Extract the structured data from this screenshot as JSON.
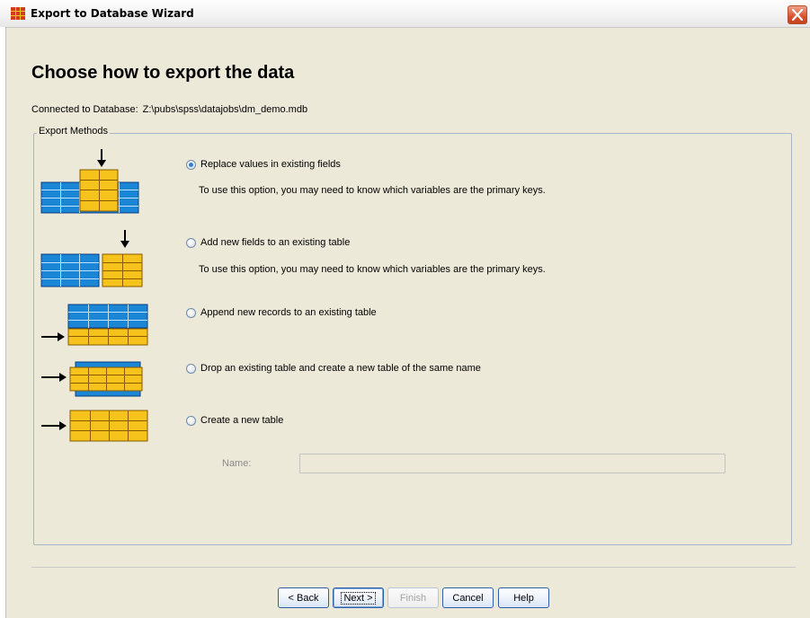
{
  "window": {
    "title": "Export to Database Wizard"
  },
  "page": {
    "heading": "Choose how to export the data",
    "connection_label": "Connected to Database:",
    "connection_path": "Z:\\pubs\\spss\\datajobs\\dm_demo.mdb"
  },
  "export_methods": {
    "legend": "Export Methods",
    "options": [
      {
        "label": "Replace values in existing fields",
        "checked": true,
        "description": "To use this option, you may need to know which variables are the primary keys."
      },
      {
        "label": "Add new fields to an existing table",
        "checked": false,
        "description": "To use this option, you may need to know which variables are the primary keys."
      },
      {
        "label": "Append new records to an existing table",
        "checked": false
      },
      {
        "label": "Drop an existing table and create a new table of the same name",
        "checked": false
      },
      {
        "label": "Create a new table",
        "checked": false
      }
    ],
    "name_label": "Name:",
    "name_value": ""
  },
  "buttons": {
    "back": "< Back",
    "next": "Next >",
    "finish": "Finish",
    "cancel": "Cancel",
    "help": "Help"
  },
  "colors": {
    "blue_cell": "#1c86d6",
    "yellow_cell": "#f6c21c",
    "accent": "#2f7fd8"
  }
}
